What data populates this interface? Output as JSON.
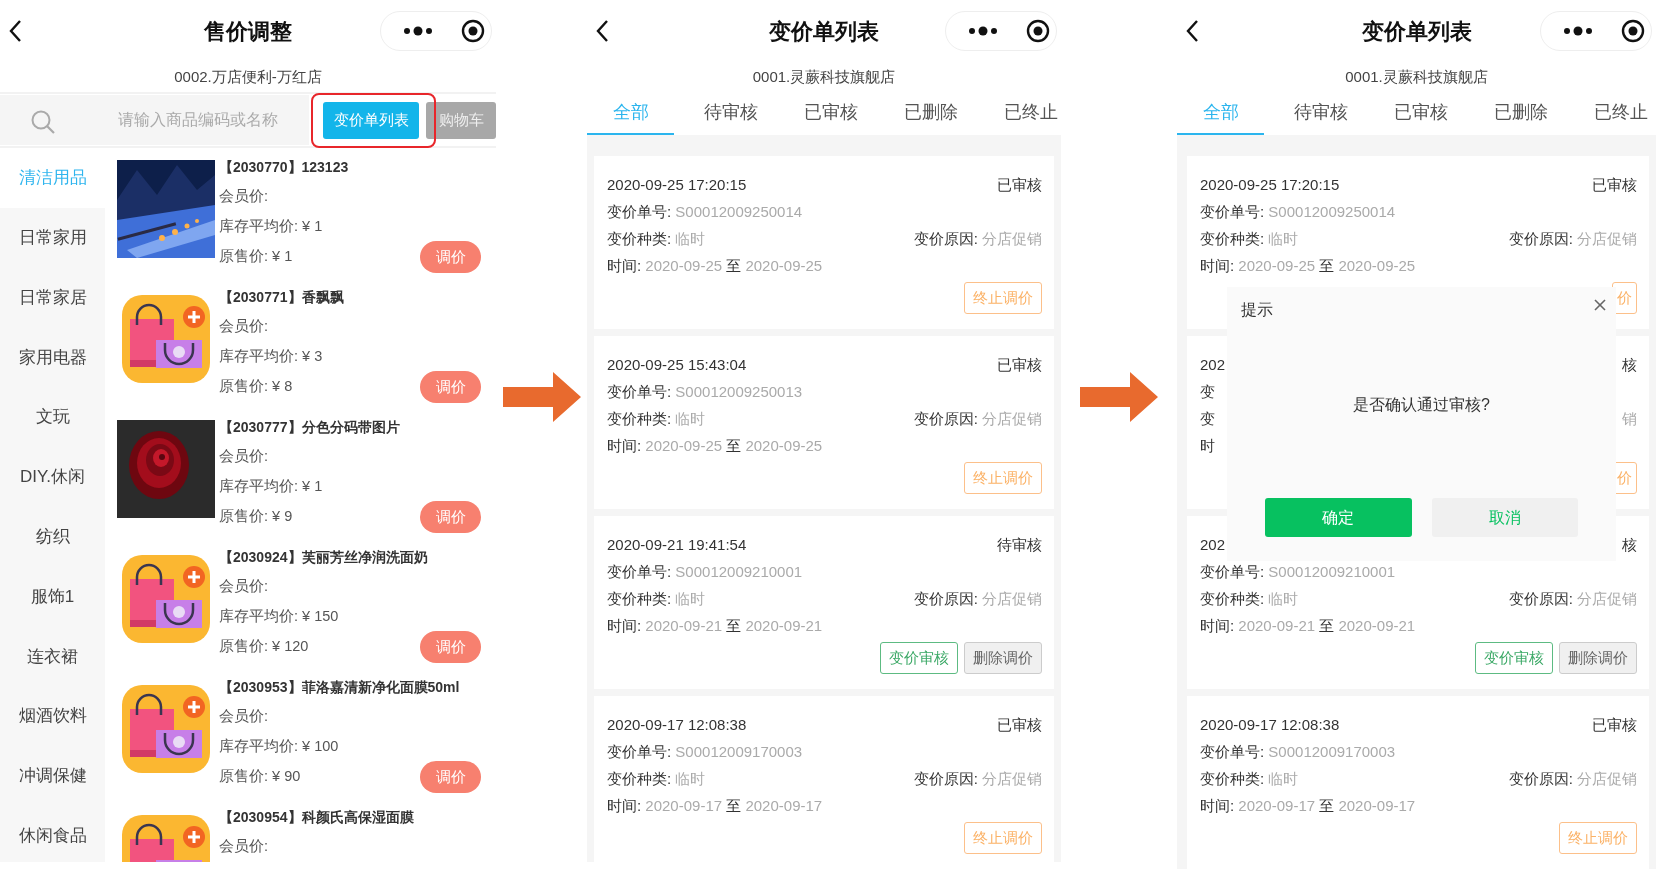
{
  "screens": [
    {
      "kind": "products",
      "title": "售价调整",
      "store": "0002.万店便利-万红店",
      "search": {
        "placeholder": "请输入商品编码或名称"
      },
      "buttons": [
        {
          "label": "变价单列表",
          "highlighted": true,
          "kind": "primary"
        },
        {
          "label": "购物车",
          "highlighted": false,
          "kind": "muted"
        }
      ],
      "categories": [
        {
          "label": "清洁用品",
          "selected": true
        },
        {
          "label": "日常家用",
          "selected": false
        },
        {
          "label": "日常家居",
          "selected": false
        },
        {
          "label": "家用电器",
          "selected": false
        },
        {
          "label": "文玩",
          "selected": false
        },
        {
          "label": "DIY.休闲",
          "selected": false
        },
        {
          "label": "纺织",
          "selected": false
        },
        {
          "label": "服饰1",
          "selected": false
        },
        {
          "label": "连衣裙",
          "selected": false
        },
        {
          "label": "烟酒饮料",
          "selected": false
        },
        {
          "label": "冲调保健",
          "selected": false
        },
        {
          "label": "休闲食品",
          "selected": false
        }
      ],
      "products": [
        {
          "title": "【2030770】123123",
          "kind": "picture",
          "lines": [
            "会员价:",
            "库存平均价: ¥ 1",
            "原售价: ¥ 1"
          ],
          "button": "调价"
        },
        {
          "title": "【2030771】香飘飘",
          "kind": "icon",
          "lines": [
            "会员价:",
            "库存平均价: ¥ 3",
            "原售价: ¥ 8"
          ],
          "button": "调价"
        },
        {
          "title": "【2030777】分色分码带图片",
          "kind": "picture",
          "lines": [
            "会员价:",
            "库存平均价: ¥ 1",
            "原售价: ¥ 9"
          ],
          "button": "调价"
        },
        {
          "title": "【2030924】芙丽芳丝净润洗面奶",
          "kind": "icon",
          "lines": [
            "会员价:",
            "库存平均价: ¥ 150",
            "原售价: ¥ 120"
          ],
          "button": "调价"
        },
        {
          "title": "【2030953】菲洛嘉清新净化面膜50ml",
          "kind": "icon",
          "lines": [
            "会员价:",
            "库存平均价: ¥ 100",
            "原售价: ¥ 90"
          ],
          "button": "调价"
        },
        {
          "title": "【2030954】科颜氏高保湿面膜",
          "kind": "icon",
          "lines": [
            "会员价:"
          ]
        }
      ]
    },
    {
      "kind": "orders",
      "title": "变价单列表",
      "store": "0001.灵蕨科技旗舰店",
      "tabs": [
        {
          "label": "全部",
          "selected": true
        },
        {
          "label": "待审核",
          "selected": false
        },
        {
          "label": "已审核",
          "selected": false
        },
        {
          "label": "已删除",
          "selected": false
        },
        {
          "label": "已终止",
          "selected": false
        }
      ],
      "orders": [
        {
          "datetime": "2020-09-25 17:20:15",
          "status": "已审核",
          "number": {
            "label": "变价单号:",
            "value": "S00012009250014"
          },
          "type": {
            "label": "变价种类:",
            "value": "临时"
          },
          "reason": {
            "label": "变价原因:",
            "value": "分店促销"
          },
          "time": {
            "label": "时间:",
            "from": "2020-09-25",
            "sep": "至",
            "to": "2020-09-25"
          },
          "actions": [
            {
              "label": "终止调价",
              "kind": "stop"
            }
          ]
        },
        {
          "datetime": "2020-09-25 15:43:04",
          "status": "已审核",
          "number": {
            "label": "变价单号:",
            "value": "S00012009250013"
          },
          "type": {
            "label": "变价种类:",
            "value": "临时"
          },
          "reason": {
            "label": "变价原因:",
            "value": "分店促销"
          },
          "time": {
            "label": "时间:",
            "from": "2020-09-25",
            "sep": "至",
            "to": "2020-09-25"
          },
          "actions": [
            {
              "label": "终止调价",
              "kind": "stop"
            }
          ]
        },
        {
          "datetime": "2020-09-21 19:41:54",
          "status": "待审核",
          "number": {
            "label": "变价单号:",
            "value": "S00012009210001"
          },
          "type": {
            "label": "变价种类:",
            "value": "临时"
          },
          "reason": {
            "label": "变价原因:",
            "value": "分店促销"
          },
          "time": {
            "label": "时间:",
            "from": "2020-09-21",
            "sep": "至",
            "to": "2020-09-21"
          },
          "actions": [
            {
              "label": "变价审核",
              "kind": "approve"
            },
            {
              "label": "删除调价",
              "kind": "delete"
            }
          ]
        },
        {
          "datetime": "2020-09-17 12:08:38",
          "status": "已审核",
          "number": {
            "label": "变价单号:",
            "value": "S00012009170003"
          },
          "type": {
            "label": "变价种类:",
            "value": "临时"
          },
          "reason": {
            "label": "变价原因:",
            "value": "分店促销"
          },
          "time": {
            "label": "时间:",
            "from": "2020-09-17",
            "sep": "至",
            "to": "2020-09-17"
          },
          "actions": [
            {
              "label": "终止调价",
              "kind": "stop"
            }
          ]
        }
      ]
    },
    {
      "kind": "orders",
      "title": "变价单列表",
      "store": "0001.灵蕨科技旗舰店",
      "tabs": [
        {
          "label": "全部",
          "selected": true
        },
        {
          "label": "待审核",
          "selected": false
        },
        {
          "label": "已审核",
          "selected": false
        },
        {
          "label": "已删除",
          "selected": false
        },
        {
          "label": "已终止",
          "selected": false
        }
      ],
      "orders": [
        {
          "datetime": "2020-09-25 17:20:15",
          "status": "已审核",
          "number": {
            "label": "变价单号:",
            "value": "S00012009250014"
          },
          "type": {
            "label": "变价种类:",
            "value": "临时"
          },
          "reason": {
            "label": "变价原因:",
            "value": "分店促销"
          },
          "time": {
            "label": "时间:",
            "from": "2020-09-25",
            "sep": "至",
            "to": "2020-09-25"
          },
          "actions": [
            {
              "label": "价",
              "kind": "stop"
            }
          ]
        },
        {
          "datetime": "202",
          "status": "核",
          "number": {
            "label": "变"
          },
          "type": {
            "label": "变"
          },
          "reason": {
            "value": "销"
          },
          "time": {
            "label": "时"
          },
          "actions": [
            {
              "label": "价",
              "kind": "stop"
            }
          ]
        },
        {
          "datetime": "202",
          "status": "核",
          "number": {
            "label": "变价单号:",
            "value": "S00012009210001"
          },
          "type": {
            "label": "变价种类:",
            "value": "临时"
          },
          "reason": {
            "label": "变价原因:",
            "value": "分店促销"
          },
          "time": {
            "label": "时间:",
            "from": "2020-09-21",
            "sep": "至",
            "to": "2020-09-21"
          },
          "actions": [
            {
              "label": "变价审核",
              "kind": "approve"
            },
            {
              "label": "删除调价",
              "kind": "delete"
            }
          ]
        },
        {
          "datetime": "2020-09-17 12:08:38",
          "status": "已审核",
          "number": {
            "label": "变价单号:",
            "value": "S00012009170003"
          },
          "type": {
            "label": "变价种类:",
            "value": "临时"
          },
          "reason": {
            "label": "变价原因:",
            "value": "分店促销"
          },
          "time": {
            "label": "时间:",
            "from": "2020-09-17",
            "sep": "至",
            "to": "2020-09-17"
          },
          "actions": [
            {
              "label": "终止调价",
              "kind": "stop"
            }
          ]
        }
      ],
      "dialog": {
        "title": "提示",
        "message": "是否确认通过审核?",
        "buttons": [
          {
            "label": "确定",
            "kind": "primary"
          },
          {
            "label": "取消",
            "kind": "secondary"
          }
        ]
      }
    }
  ]
}
